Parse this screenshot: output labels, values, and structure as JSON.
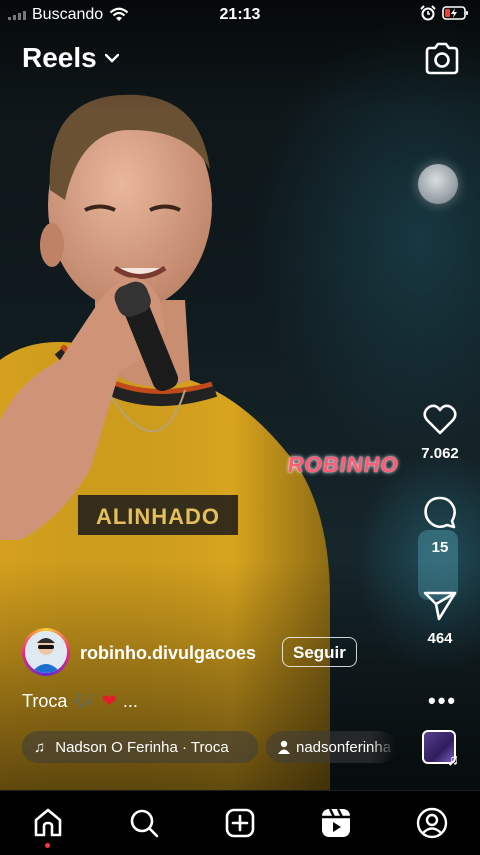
{
  "status_bar": {
    "carrier": "Buscando",
    "time": "21:13"
  },
  "header": {
    "title": "Reels"
  },
  "video": {
    "watermark": "ROBINHO",
    "shirt_text": "ALINHADO"
  },
  "actions": {
    "likes": "7.062",
    "comments": "15",
    "shares": "464"
  },
  "creator": {
    "username": "robinho.divulgacoes",
    "follow_label": "Seguir"
  },
  "caption": {
    "text": "Troca",
    "more": "..."
  },
  "audio": {
    "track": "Nadson O Ferinha · Troca",
    "tagged_user": "nadsonferinha"
  },
  "colors": {
    "notification_dot": "#ff3040",
    "like_heart": "#e41d2a",
    "watermark": "#ff5a75"
  },
  "icons": [
    "wifi-icon",
    "alarm-icon",
    "battery-icon",
    "chevron-down-icon",
    "camera-icon",
    "heart-icon",
    "comment-icon",
    "share-icon",
    "more-icon",
    "music-note-icon",
    "person-icon",
    "home-icon",
    "search-icon",
    "create-icon",
    "reels-icon",
    "profile-icon"
  ]
}
